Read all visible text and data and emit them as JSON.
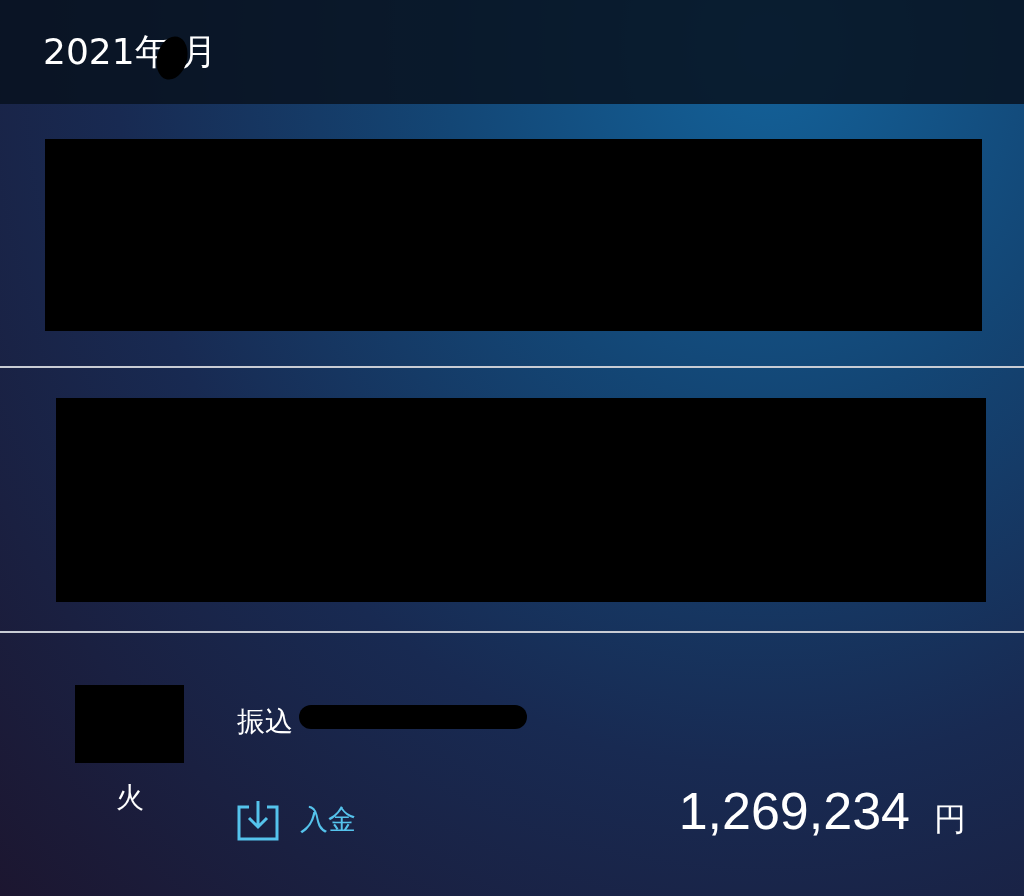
{
  "header": {
    "year": "2021年",
    "month_suffix": "月"
  },
  "transaction": {
    "weekday": "火",
    "description": "振込",
    "kind": "deposit",
    "type_label": "入金",
    "amount": "1,269,234",
    "currency": "円"
  }
}
